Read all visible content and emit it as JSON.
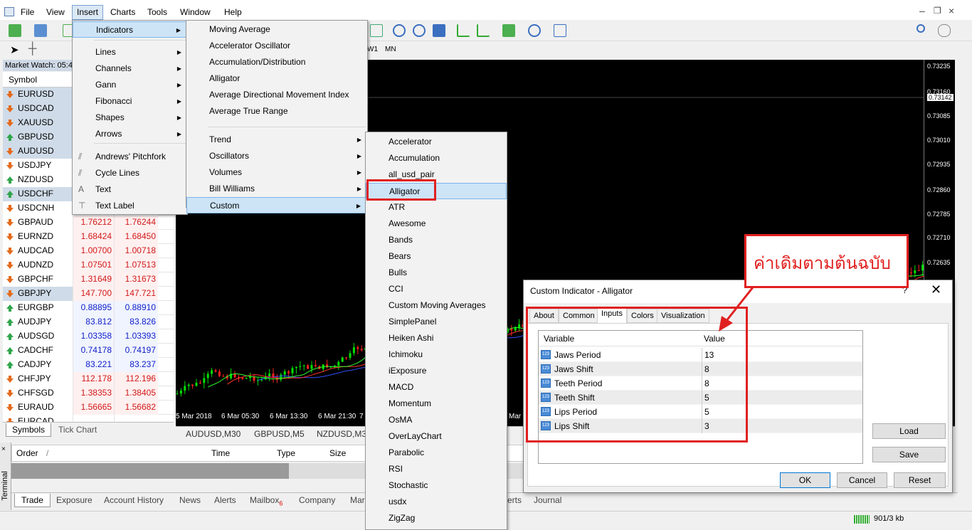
{
  "menubar": [
    "File",
    "View",
    "Insert",
    "Charts",
    "Tools",
    "Window",
    "Help"
  ],
  "market_watch": {
    "title": "Market Watch: 05:4",
    "column_symbol": "Symbol",
    "rows": [
      {
        "symbol": "EURUSD",
        "bid": "",
        "ask": "",
        "dir": "down",
        "hl": true
      },
      {
        "symbol": "USDCAD",
        "bid": "",
        "ask": "",
        "dir": "down",
        "hl": true
      },
      {
        "symbol": "XAUUSD",
        "bid": "",
        "ask": "",
        "dir": "down",
        "hl": true
      },
      {
        "symbol": "GBPUSD",
        "bid": "",
        "ask": "",
        "dir": "up",
        "hl": true
      },
      {
        "symbol": "AUDUSD",
        "bid": "",
        "ask": "",
        "dir": "down",
        "hl": true
      },
      {
        "symbol": "USDJPY",
        "bid": "",
        "ask": "",
        "dir": "down",
        "hl": false
      },
      {
        "symbol": "NZDUSD",
        "bid": "",
        "ask": "",
        "dir": "up",
        "hl": false
      },
      {
        "symbol": "USDCHF",
        "bid": "",
        "ask": "",
        "dir": "up",
        "hl": true
      },
      {
        "symbol": "USDCNH",
        "bid": "",
        "ask": "",
        "dir": "down",
        "hl": false
      },
      {
        "symbol": "GBPAUD",
        "bid": "1.76212",
        "ask": "1.76244",
        "dir": "down",
        "hl": false,
        "red": true
      },
      {
        "symbol": "EURNZD",
        "bid": "1.68424",
        "ask": "1.68450",
        "dir": "down",
        "hl": false,
        "red": true
      },
      {
        "symbol": "AUDCAD",
        "bid": "1.00700",
        "ask": "1.00718",
        "dir": "down",
        "hl": false,
        "red": true
      },
      {
        "symbol": "AUDNZD",
        "bid": "1.07501",
        "ask": "1.07513",
        "dir": "down",
        "hl": false,
        "red": true
      },
      {
        "symbol": "GBPCHF",
        "bid": "1.31649",
        "ask": "1.31673",
        "dir": "down",
        "hl": false,
        "red": true
      },
      {
        "symbol": "GBPJPY",
        "bid": "147.700",
        "ask": "147.721",
        "dir": "down",
        "hl": true,
        "red": true
      },
      {
        "symbol": "EURGBP",
        "bid": "0.88895",
        "ask": "0.88910",
        "dir": "up",
        "hl": false,
        "red": false
      },
      {
        "symbol": "AUDJPY",
        "bid": "83.812",
        "ask": "83.826",
        "dir": "up",
        "hl": false,
        "red": false
      },
      {
        "symbol": "AUDSGD",
        "bid": "1.03358",
        "ask": "1.03393",
        "dir": "up",
        "hl": false,
        "red": false
      },
      {
        "symbol": "CADCHF",
        "bid": "0.74178",
        "ask": "0.74197",
        "dir": "up",
        "hl": false,
        "red": false
      },
      {
        "symbol": "CADJPY",
        "bid": "83.221",
        "ask": "83.237",
        "dir": "up",
        "hl": false,
        "red": false
      },
      {
        "symbol": "CHFJPY",
        "bid": "112.178",
        "ask": "112.196",
        "dir": "down",
        "hl": false,
        "red": true
      },
      {
        "symbol": "CHFSGD",
        "bid": "1.38353",
        "ask": "1.38405",
        "dir": "down",
        "hl": false,
        "red": true
      },
      {
        "symbol": "EURAUD",
        "bid": "1.56665",
        "ask": "1.56682",
        "dir": "down",
        "hl": false,
        "red": true
      },
      {
        "symbol": "EURCAD",
        "bid": "",
        "ask": "",
        "dir": "down",
        "hl": false,
        "red": true
      }
    ],
    "tabs": [
      "Symbols",
      "Tick Chart"
    ]
  },
  "toolbar2": {
    "w1": "W1",
    "mn": "MN"
  },
  "insert_menu": {
    "items": [
      {
        "label": "Indicators",
        "sub": true,
        "hl": true
      },
      {
        "label": "Lines",
        "sub": true
      },
      {
        "label": "Channels",
        "sub": true
      },
      {
        "label": "Gann",
        "sub": true
      },
      {
        "label": "Fibonacci",
        "sub": true
      },
      {
        "label": "Shapes",
        "sub": true
      },
      {
        "label": "Arrows",
        "sub": true
      },
      {
        "label": "Andrews' Pitchfork",
        "icon": true
      },
      {
        "label": "Cycle Lines",
        "icon": true
      },
      {
        "label": "Text",
        "icon": true
      },
      {
        "label": "Text Label",
        "icon": true
      }
    ]
  },
  "indicators_menu": {
    "items": [
      "Moving Average",
      "Accelerator Oscillator",
      "Accumulation/Distribution",
      "Alligator",
      "Average Directional Movement Index",
      "Average True Range"
    ],
    "groups": [
      "Trend",
      "Oscillators",
      "Volumes",
      "Bill Williams",
      "Custom"
    ]
  },
  "custom_menu": {
    "items": [
      "Accelerator",
      "Accumulation",
      "all_usd_pair",
      "Alligator",
      "ATR",
      "Awesome",
      "Bands",
      "Bears",
      "Bulls",
      "CCI",
      "Custom Moving Averages",
      "SimplePanel",
      "Heiken Ashi",
      "Ichimoku",
      "iExposure",
      "MACD",
      "Momentum",
      "OsMA",
      "OverLayChart",
      "Parabolic",
      "RSI",
      "Stochastic",
      "usdx",
      "ZigZag"
    ]
  },
  "chart": {
    "price_labels": [
      "0.73235",
      "0.73160",
      "0.73142",
      "0.73085",
      "0.73010",
      "0.72935",
      "0.72860",
      "0.72785",
      "0.72710",
      "0.72635"
    ],
    "time_labels": [
      "5 Mar 2018",
      "6 Mar 05:30",
      "6 Mar 13:30",
      "6 Mar 21:30",
      "7",
      "Mar 2"
    ],
    "tabs": [
      "AUDUSD,M30",
      "GBPUSD,M5",
      "NZDUSD,M3"
    ]
  },
  "terminal": {
    "side_label": "Terminal",
    "columns": [
      "Order",
      "/",
      "Time",
      "Type",
      "Size"
    ],
    "tabs": [
      "Trade",
      "Exposure",
      "Account History",
      "News",
      "Alerts",
      "Mailbox",
      "Company",
      "Mar",
      "erts",
      "Journal"
    ],
    "mailbox_badge": "6"
  },
  "dialog": {
    "title": "Custom Indicator - Alligator",
    "help": "?",
    "tabs": [
      "About",
      "Common",
      "Inputs",
      "Colors",
      "Visualization"
    ],
    "col_variable": "Variable",
    "col_value": "Value",
    "rows": [
      {
        "variable": "Jaws Period",
        "value": "13"
      },
      {
        "variable": "Jaws Shift",
        "value": "8"
      },
      {
        "variable": "Teeth Period",
        "value": "8"
      },
      {
        "variable": "Teeth Shift",
        "value": "5"
      },
      {
        "variable": "Lips Period",
        "value": "5"
      },
      {
        "variable": "Lips Shift",
        "value": "3"
      }
    ],
    "load": "Load",
    "save": "Save",
    "ok": "OK",
    "cancel": "Cancel",
    "reset": "Reset"
  },
  "callout": "ค่าเดิมตามต้นฉบับ",
  "status": {
    "traffic": "901/3 kb"
  },
  "colors": {
    "accent_red": "#e02020",
    "bull": "#00d000",
    "bear": "#ff2020"
  }
}
